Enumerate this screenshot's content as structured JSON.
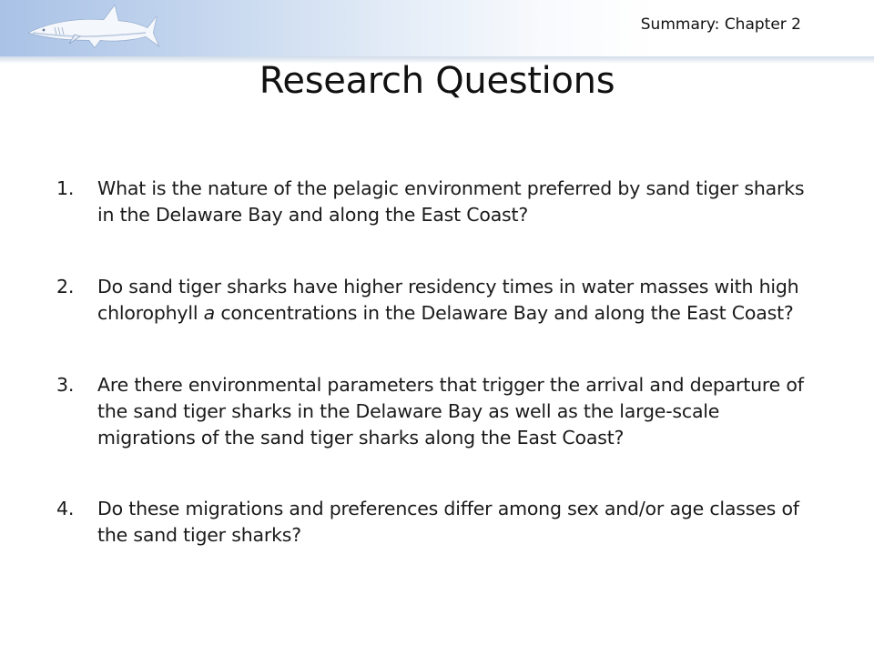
{
  "header": {
    "chapter_label": "Summary: Chapter 2"
  },
  "logo": {
    "icon": "shark-logo-icon"
  },
  "title": "Research Questions",
  "questions": [
    {
      "number": "1.",
      "text": "What is the nature of the pelagic environment preferred by sand tiger sharks in the Delaware Bay and along the East Coast?"
    },
    {
      "number": "2.",
      "text_before": "Do sand tiger sharks have higher residency times in water masses with high chlorophyll ",
      "text_italic": "a",
      "text_after": " concentrations in the Delaware Bay and along the East Coast?"
    },
    {
      "number": "3.",
      "text": "Are there environmental parameters that trigger the arrival and departure of the sand tiger sharks in the Delaware Bay as well as the large-scale migrations of the sand tiger sharks along the East Coast?"
    },
    {
      "number": "4.",
      "text": "Do these migrations and preferences differ among sex and/or age classes of the sand tiger sharks?"
    }
  ],
  "colors": {
    "header_gradient_start": "#a9c2e6",
    "text": "#1a1a1a",
    "logo_fill": "#ffffff"
  }
}
